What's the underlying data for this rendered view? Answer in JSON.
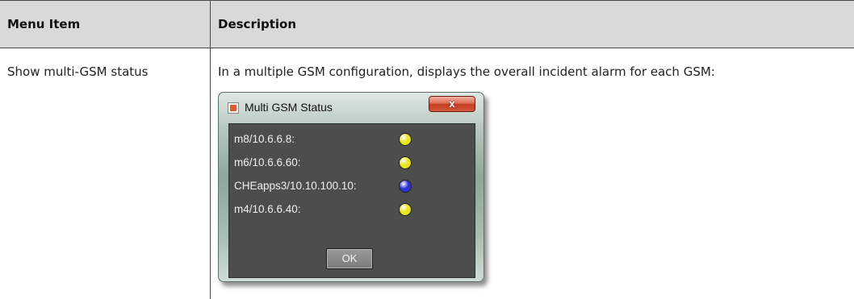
{
  "table": {
    "headers": [
      "Menu Item",
      "Description"
    ],
    "row": {
      "menu_item": "Show multi-GSM status",
      "description": "In a multiple GSM configuration, displays the overall incident alarm for each GSM:"
    }
  },
  "dialog": {
    "title": "Multi GSM Status",
    "close_label": "x",
    "ok_label": "OK",
    "items": [
      {
        "label": "m8/10.6.6.8:",
        "status_color": "#e8e51a"
      },
      {
        "label": "m6/10.6.6.60:",
        "status_color": "#e8e51a"
      },
      {
        "label": "CHEapps3/10.10.100.10:",
        "status_color": "#2a33d6"
      },
      {
        "label": "m4/10.6.6.40:",
        "status_color": "#e8e51a"
      }
    ]
  },
  "colors": {
    "header_bg": "#d9d9d9",
    "border": "#4a4a4a",
    "dialog_body": "#4d4d4d",
    "alarm_yellow": "#e8e51a",
    "alarm_blue": "#2a33d6"
  },
  "icons": {
    "app": "java-app-icon",
    "close": "close-icon"
  }
}
